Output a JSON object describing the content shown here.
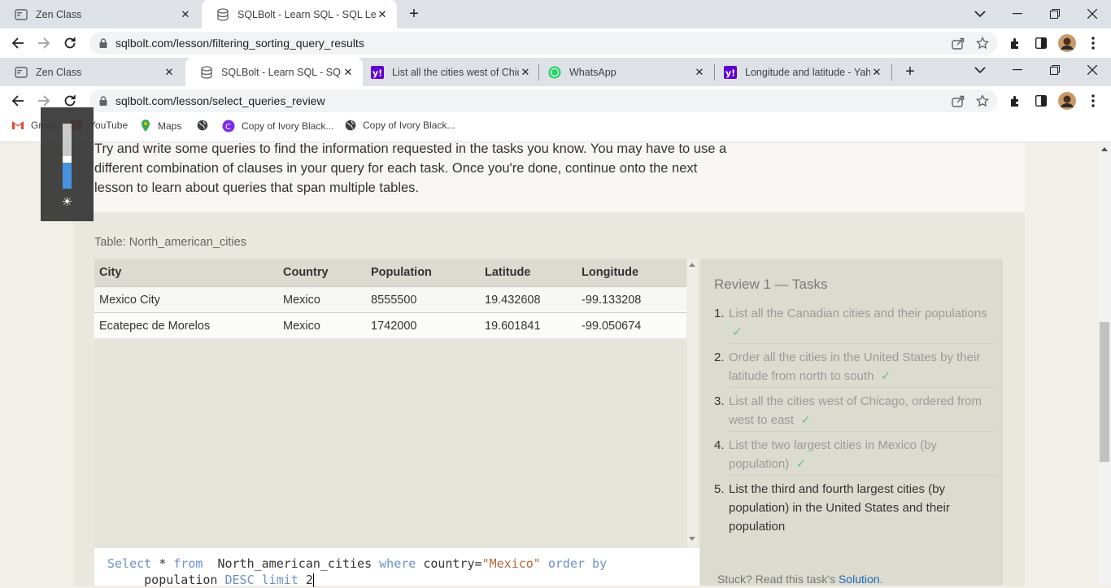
{
  "window_back": {
    "tabs": [
      {
        "title": "Zen Class"
      },
      {
        "title": "SQLBolt - Learn SQL - SQL Lesson"
      }
    ],
    "url": "sqlbolt.com/lesson/filtering_sorting_query_results"
  },
  "window_front": {
    "tabs": [
      {
        "title": "Zen Class"
      },
      {
        "title": "SQLBolt - Learn SQL - SQL Review"
      },
      {
        "title": "List all the cities west of Chicago"
      },
      {
        "title": "WhatsApp"
      },
      {
        "title": "Longitude and latitude - Yahoo"
      }
    ],
    "url": "sqlbolt.com/lesson/select_queries_review",
    "bookmarks": [
      {
        "label": "Gmail",
        "icon": "gmail-icon"
      },
      {
        "label": "YouTube",
        "icon": "youtube-icon"
      },
      {
        "label": "Maps",
        "icon": "maps-icon"
      },
      {
        "label": "",
        "icon": "globe-icon"
      },
      {
        "label": "Copy of Ivory Black...",
        "icon": "canva-icon"
      },
      {
        "label": "Copy of Ivory Black...",
        "icon": "globe-icon"
      }
    ]
  },
  "lesson": {
    "intro_lines": [
      "Try and write some queries to find the information requested in the tasks you know. You may have to use a",
      "different combination of clauses in your query for each task. Once you're done, continue onto the next",
      "lesson to learn about queries that span multiple tables."
    ],
    "table_title": "Table: North_american_cities",
    "columns": [
      "City",
      "Country",
      "Population",
      "Latitude",
      "Longitude"
    ],
    "rows": [
      [
        "Mexico City",
        "Mexico",
        "8555500",
        "19.432608",
        "-99.133208"
      ],
      [
        "Ecatepec de Morelos",
        "Mexico",
        "1742000",
        "19.601841",
        "-99.050674"
      ]
    ],
    "query": {
      "kw_select": "Select",
      "star": "*",
      "kw_from": "from",
      "table": "North_american_cities",
      "kw_where": "where",
      "cond": "country=",
      "str": "\"Mexico\"",
      "kw_order": "order by",
      "col": "population",
      "kw_desc": "DESC",
      "kw_limit": "limit",
      "num": "2"
    },
    "tasks_title": "Review 1 — Tasks",
    "tasks": [
      {
        "num": "1.",
        "text": "List all the Canadian cities and their populations",
        "done": true
      },
      {
        "num": "2.",
        "text": "Order all the cities in the United States by their latitude from north to south",
        "done": true
      },
      {
        "num": "3.",
        "text": "List all the cities west of Chicago, ordered from west to east",
        "done": true
      },
      {
        "num": "4.",
        "text": "List the two largest cities in Mexico (by population)",
        "done": true
      },
      {
        "num": "5.",
        "text": "List the third and fourth largest cities (by population) in the United States and their population",
        "done": false
      }
    ],
    "check_mark": "✓",
    "stuck_text": "Stuck? Read this task's ",
    "solution_link": "Solution",
    "stuck_end": "."
  },
  "colors": {
    "accent_blue": "#1c6bb6",
    "check_green": "#6fc17c",
    "keyword": "#6c8fd0"
  },
  "brightness_level": 0.4
}
